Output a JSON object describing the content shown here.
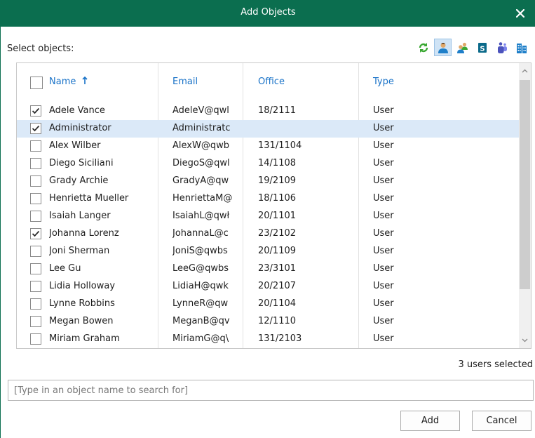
{
  "window": {
    "title": "Add Objects"
  },
  "select_label": "Select objects:",
  "toolbar_icons": [
    {
      "name": "refresh-icon",
      "color": "#3aa832",
      "active": false
    },
    {
      "name": "user-icon",
      "color": "#1e7fc9",
      "active": true
    },
    {
      "name": "group-icon",
      "color": "#1e7fc9",
      "active": false
    },
    {
      "name": "sharepoint-icon",
      "color": "#0b6a8a",
      "active": false
    },
    {
      "name": "teams-icon",
      "color": "#4b53bc",
      "active": false
    },
    {
      "name": "organization-icon",
      "color": "#1e7fc9",
      "active": false
    }
  ],
  "grid": {
    "columns": {
      "name": "Name",
      "email": "Email",
      "office": "Office",
      "type": "Type"
    },
    "rows": [
      {
        "name": "Adele Vance",
        "email": "AdeleV@qwl",
        "office": "18/2111",
        "type": "User",
        "checked": true,
        "highlighted": false
      },
      {
        "name": "Administrator",
        "email": "Administratc",
        "office": "",
        "type": "User",
        "checked": true,
        "highlighted": true
      },
      {
        "name": "Alex Wilber",
        "email": "AlexW@qwb",
        "office": "131/1104",
        "type": "User",
        "checked": false,
        "highlighted": false
      },
      {
        "name": "Diego Siciliani",
        "email": "DiegoS@qwl",
        "office": "14/1108",
        "type": "User",
        "checked": false,
        "highlighted": false
      },
      {
        "name": "Grady Archie",
        "email": "GradyA@qw",
        "office": "19/2109",
        "type": "User",
        "checked": false,
        "highlighted": false
      },
      {
        "name": "Henrietta Mueller",
        "email": "HenriettaM@",
        "office": "18/1106",
        "type": "User",
        "checked": false,
        "highlighted": false
      },
      {
        "name": "Isaiah Langer",
        "email": "IsaiahL@qwł",
        "office": "20/1101",
        "type": "User",
        "checked": false,
        "highlighted": false
      },
      {
        "name": "Johanna Lorenz",
        "email": "JohannaL@c",
        "office": "23/2102",
        "type": "User",
        "checked": true,
        "highlighted": false
      },
      {
        "name": "Joni Sherman",
        "email": "JoniS@qwbs",
        "office": "20/1109",
        "type": "User",
        "checked": false,
        "highlighted": false
      },
      {
        "name": "Lee Gu",
        "email": "LeeG@qwbs",
        "office": "23/3101",
        "type": "User",
        "checked": false,
        "highlighted": false
      },
      {
        "name": "Lidia Holloway",
        "email": "LidiaH@qwk",
        "office": "20/2107",
        "type": "User",
        "checked": false,
        "highlighted": false
      },
      {
        "name": "Lynne Robbins",
        "email": "LynneR@qw",
        "office": "20/1104",
        "type": "User",
        "checked": false,
        "highlighted": false
      },
      {
        "name": "Megan Bowen",
        "email": "MeganB@qv",
        "office": "12/1110",
        "type": "User",
        "checked": false,
        "highlighted": false
      },
      {
        "name": "Miriam Graham",
        "email": "MiriamG@q\\",
        "office": "131/2103",
        "type": "User",
        "checked": false,
        "highlighted": false
      }
    ]
  },
  "status": "3 users selected",
  "search": {
    "placeholder": "[Type in an object name to search for]",
    "value": ""
  },
  "buttons": {
    "add": "Add",
    "cancel": "Cancel"
  },
  "colors": {
    "titlebar": "#0b6e4f",
    "header_text": "#1a73c8",
    "highlight": "#dbe9f8"
  }
}
